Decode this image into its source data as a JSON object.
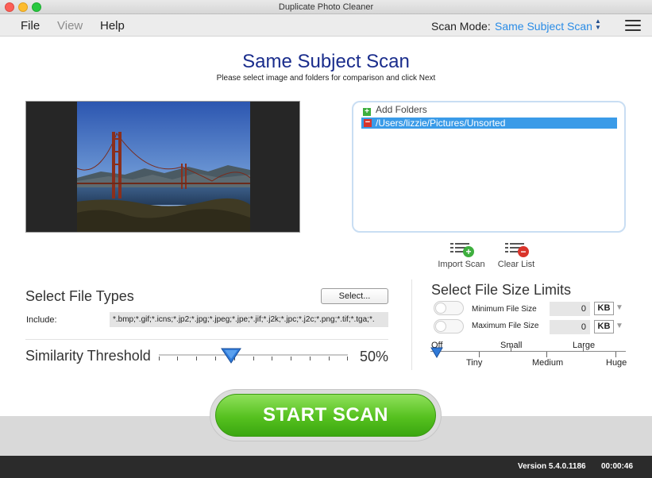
{
  "window": {
    "title": "Duplicate Photo Cleaner"
  },
  "menu": {
    "items": [
      {
        "label": "File",
        "enabled": true
      },
      {
        "label": "View",
        "enabled": false
      },
      {
        "label": "Help",
        "enabled": true
      }
    ],
    "scan_mode_label": "Scan Mode:",
    "scan_mode_value": "Same Subject Scan"
  },
  "header": {
    "title": "Same Subject Scan",
    "subtitle": "Please select image and folders for comparison and click Next"
  },
  "folders": {
    "add_label": "Add Folders",
    "items": [
      "/Users/lizzie/Pictures/Unsorted"
    ],
    "import_label": "Import Scan",
    "clear_label": "Clear List"
  },
  "file_types": {
    "title": "Select File Types",
    "select_button": "Select...",
    "include_label": "Include:",
    "include_value": "*.bmp;*.gif;*.icns;*.jp2;*.jpg;*.jpeg;*.jpe;*.jif;*.j2k;*.jpc;*.j2c;*.png;*.tif;*.tga;*."
  },
  "similarity": {
    "title": "Similarity Threshold",
    "value": 50,
    "value_label": "50%"
  },
  "size_limits": {
    "title": "Select File Size Limits",
    "min_label": "Minimum File Size",
    "min_value": "0",
    "min_unit": "KB",
    "min_enabled": false,
    "max_label": "Maximum File Size",
    "max_value": "0",
    "max_unit": "KB",
    "max_enabled": false,
    "scale_top": [
      "Off",
      "Small",
      "Large"
    ],
    "scale_bottom": [
      "Tiny",
      "Medium",
      "Huge"
    ],
    "selected": "Off"
  },
  "actions": {
    "start_label": "START SCAN"
  },
  "status": {
    "version": "Version 5.4.0.1186",
    "time": "00:00:46"
  },
  "colors": {
    "accent": "#2a8ce6",
    "title": "#1a2d8c",
    "start": "#56c11f",
    "selection": "#3a9be8"
  }
}
